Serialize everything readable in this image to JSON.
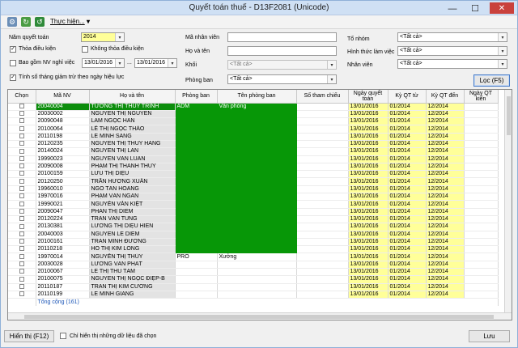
{
  "window": {
    "title": "Quyết toán thuế - D13F2081 (Unicode)",
    "minimize": "—",
    "maximize": "☐",
    "close": "✕"
  },
  "toolbar": {
    "menu_label": "Thực hiện...",
    "menu_arrow": "▾"
  },
  "filters": {
    "year_label": "Năm quyết toán",
    "year_value": "2014",
    "satisfy_label": "Thỏa điều kiện",
    "not_satisfy_label": "Không thỏa điều kiện",
    "leave_label": "Bao gồm NV nghỉ việc",
    "date_from": "13/01/2016",
    "date_to": "13/01/2016",
    "range_sep": "...",
    "months_label": "Tính số tháng giảm trừ theo ngày hiệu lực",
    "emp_code_label": "Mã nhân viên",
    "name_label": "Họ và tên",
    "block_label": "Khối",
    "block_value": "<Tất cả>",
    "dept_label": "Phòng ban",
    "dept_value": "<Tất cả>",
    "group_label": "Tổ nhóm",
    "group_value": "<Tất cả>",
    "work_form_label": "Hình thức làm việc",
    "work_form_value": "<Tất cả>",
    "employee_label": "Nhân viên",
    "employee_value": "<Tất cả>",
    "filter_button": "Lọc (F5)"
  },
  "columns": [
    "Chọn",
    "Mã NV",
    "Họ và tên",
    "Phòng ban",
    "Tên phòng ban",
    "Số tham chiếu",
    "Ngày quyết toán",
    "Kỳ QT từ",
    "Kỳ QT đến",
    "Ngày QT kiến"
  ],
  "rows": [
    {
      "code": "20040004",
      "name": "TƯỞNG THỊ THÚY TRINH",
      "dept": "ADM",
      "dept_name": "Văn phòng",
      "date": "13/01/2016",
      "from": "01/2014",
      "to": "12/2014",
      "selected": true
    },
    {
      "code": "20030002",
      "name": "NGUYỄN THỊ NGUYÊN",
      "dept": "",
      "dept_name": "",
      "date": "13/01/2016",
      "from": "01/2014",
      "to": "12/2014"
    },
    {
      "code": "20090048",
      "name": "LÂM NGỌC HÂN",
      "dept": "",
      "dept_name": "",
      "date": "13/01/2016",
      "from": "01/2014",
      "to": "12/2014"
    },
    {
      "code": "20100064",
      "name": "LÊ THỊ NGỌC THẢO",
      "dept": "",
      "dept_name": "",
      "date": "13/01/2016",
      "from": "01/2014",
      "to": "12/2014"
    },
    {
      "code": "20110198",
      "name": "LÊ MINH SANG",
      "dept": "",
      "dept_name": "",
      "date": "13/01/2016",
      "from": "01/2014",
      "to": "12/2014"
    },
    {
      "code": "20120235",
      "name": "NGUYỄN THỊ THÚY HẰNG",
      "dept": "",
      "dept_name": "",
      "date": "13/01/2016",
      "from": "01/2014",
      "to": "12/2014"
    },
    {
      "code": "20140024",
      "name": "NGUYỄN THỊ LAN",
      "dept": "",
      "dept_name": "",
      "date": "13/01/2016",
      "from": "01/2014",
      "to": "12/2014"
    },
    {
      "code": "19990023",
      "name": "NGUYỄN VĂN LUÂN",
      "dept": "",
      "dept_name": "",
      "date": "13/01/2016",
      "from": "01/2014",
      "to": "12/2014"
    },
    {
      "code": "20090008",
      "name": "PHẠM THỊ THANH THÚY",
      "dept": "",
      "dept_name": "",
      "date": "13/01/2016",
      "from": "01/2014",
      "to": "12/2014"
    },
    {
      "code": "20100159",
      "name": "LƯU THỊ DIỆU",
      "dept": "",
      "dept_name": "",
      "date": "13/01/2016",
      "from": "01/2014",
      "to": "12/2014"
    },
    {
      "code": "20120250",
      "name": "TRẦN HƯƠNG XUÂN",
      "dept": "",
      "dept_name": "",
      "date": "13/01/2016",
      "from": "01/2014",
      "to": "12/2014"
    },
    {
      "code": "19960010",
      "name": "NGÔ TẤN HOÀNG",
      "dept": "",
      "dept_name": "",
      "date": "13/01/2016",
      "from": "01/2014",
      "to": "12/2014"
    },
    {
      "code": "19970016",
      "name": "PHẠM VĂN NGÂN",
      "dept": "",
      "dept_name": "",
      "date": "13/01/2016",
      "from": "01/2014",
      "to": "12/2014"
    },
    {
      "code": "19990021",
      "name": "NGUYỄN VĂN KIỆT",
      "dept": "",
      "dept_name": "",
      "date": "13/01/2016",
      "from": "01/2014",
      "to": "12/2014"
    },
    {
      "code": "20090047",
      "name": "PHAN THỊ DIỄM",
      "dept": "",
      "dept_name": "",
      "date": "13/01/2016",
      "from": "01/2014",
      "to": "12/2014"
    },
    {
      "code": "20120224",
      "name": "TRẦN VĂN TÙNG",
      "dept": "",
      "dept_name": "",
      "date": "13/01/2016",
      "from": "01/2014",
      "to": "12/2014"
    },
    {
      "code": "20130381",
      "name": "LƯƠNG THỊ DIỆU HIỀN",
      "dept": "",
      "dept_name": "",
      "date": "13/01/2016",
      "from": "01/2014",
      "to": "12/2014"
    },
    {
      "code": "20040003",
      "name": "NGUYỄN LÊ DIỄM",
      "dept": "",
      "dept_name": "",
      "date": "13/01/2016",
      "from": "01/2014",
      "to": "12/2014"
    },
    {
      "code": "20100161",
      "name": "TRẦN MINH ĐƯƠNG",
      "dept": "",
      "dept_name": "",
      "date": "13/01/2016",
      "from": "01/2014",
      "to": "12/2014"
    },
    {
      "code": "20110218",
      "name": "HỒ THỊ KIM LONG",
      "dept": "",
      "dept_name": "",
      "date": "13/01/2016",
      "from": "01/2014",
      "to": "12/2014"
    },
    {
      "code": "19970014",
      "name": "NGUYỄN THỊ THÚY",
      "dept": "PRO",
      "dept_name": "Xưởng",
      "date": "13/01/2016",
      "from": "01/2014",
      "to": "12/2014"
    },
    {
      "code": "20030028",
      "name": "LƯƠNG VĂN PHÁT",
      "dept": "",
      "dept_name": "",
      "date": "13/01/2016",
      "from": "01/2014",
      "to": "12/2014"
    },
    {
      "code": "20100067",
      "name": "LÊ THỊ THU TÂM",
      "dept": "",
      "dept_name": "",
      "date": "13/01/2016",
      "from": "01/2014",
      "to": "12/2014"
    },
    {
      "code": "20100075",
      "name": "NGUYỄN THỊ NGỌC ĐIỆP-B",
      "dept": "",
      "dept_name": "",
      "date": "13/01/2016",
      "from": "01/2014",
      "to": "12/2014"
    },
    {
      "code": "20110187",
      "name": "TRẦN THỊ KIM CƯƠNG",
      "dept": "",
      "dept_name": "",
      "date": "13/01/2016",
      "from": "01/2014",
      "to": "12/2014"
    },
    {
      "code": "20110199",
      "name": "LÊ MINH GIANG",
      "dept": "",
      "dept_name": "",
      "date": "13/01/2016",
      "from": "01/2014",
      "to": "12/2014"
    }
  ],
  "total": {
    "label": "Tổng cộng (161)"
  },
  "footer": {
    "show_button": "Hiển thị (F12)",
    "only_selected_label": "Chỉ hiển thị những dữ liệu đã chọn",
    "save_button": "Lưu"
  },
  "colors": {
    "green": "#079707",
    "yellow": "#ffff99",
    "gray": "#e3e3e3"
  }
}
